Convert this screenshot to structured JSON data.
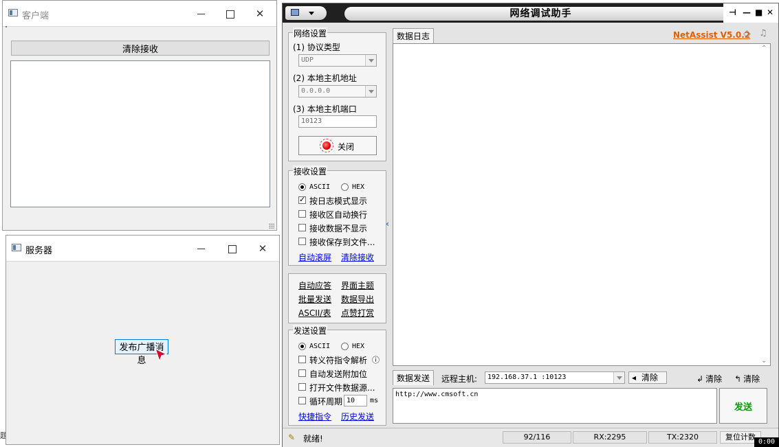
{
  "client": {
    "title": "客户端",
    "clear_button": "清除接收"
  },
  "server": {
    "title": "服务器",
    "broadcast_button": "发布广播消息"
  },
  "netassist": {
    "title": "网络调试助手",
    "brand": "NetAssist V5.0.2",
    "network": {
      "group": "网络设置",
      "protocol_label": "(1) 协议类型",
      "protocol_value": "UDP",
      "host_label": "(2) 本地主机地址",
      "host_value": "0.0.0.0",
      "port_label": "(3) 本地主机端口",
      "port_value": "10123",
      "close_button": "关闭"
    },
    "recv": {
      "group": "接收设置",
      "ascii": "ASCII",
      "hex": "HEX",
      "opt_log": "按日志模式显示",
      "opt_wrap": "接收区自动换行",
      "opt_hide": "接收数据不显示",
      "opt_save": "接收保存到文件...",
      "link_scroll": "自动滚屏",
      "link_clear": "清除接收"
    },
    "tools": {
      "auto_reply": "自动应答",
      "theme": "界面主题",
      "batch_send": "批量发送",
      "export": "数据导出",
      "ascii_table": "ASCII/表",
      "tip": "点赞打赏"
    },
    "send": {
      "group": "发送设置",
      "ascii": "ASCII",
      "hex": "HEX",
      "opt_escape": "转义符指令解析",
      "opt_append": "自动发送附加位",
      "opt_file": "打开文件数据源...",
      "opt_loop": "循环周期",
      "loop_value": "10",
      "loop_unit": "ms",
      "link_shortcut": "快捷指令",
      "link_history": "历史发送"
    },
    "log_tab": "数据日志",
    "send_tab": "数据发送",
    "remote_label": "远程主机:",
    "remote_value": "192.168.37.1 :10123",
    "clear_remote": "清除",
    "clear_left": "清除",
    "clear_right": "清除",
    "send_text": "http://www.cmsoft.cn",
    "send_button": "发送",
    "status": {
      "ready": "就绪!",
      "count": "92/116",
      "rx": "RX:2295",
      "tx": "TX:2320",
      "reset": "复位计数"
    }
  },
  "timer": "0:00"
}
